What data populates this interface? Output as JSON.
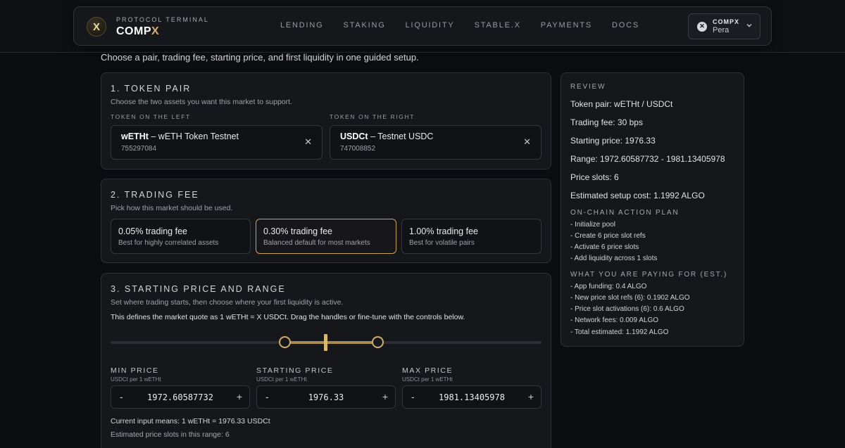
{
  "header": {
    "brand_sub": "PROTOCOL TERMINAL",
    "brand_name_main": "COMP",
    "brand_name_accent": "X",
    "logo_glyph": "X",
    "nav": [
      "LENDING",
      "STAKING",
      "LIQUIDITY",
      "STABLE.X",
      "PAYMENTS",
      "DOCS"
    ],
    "wallet": {
      "label": "COMPX",
      "name": "Pera",
      "icon": "pera-wallet-icon"
    }
  },
  "subtitle": "Choose a pair, trading fee, starting price, and first liquidity in one guided setup.",
  "token_pair": {
    "title": "1. TOKEN PAIR",
    "desc": "Choose the two assets you want this market to support.",
    "left_label": "TOKEN ON THE LEFT",
    "right_label": "TOKEN ON THE RIGHT",
    "left": {
      "symbol": "wETHt",
      "name": " – wETH Token Testnet",
      "id": "755297084"
    },
    "right": {
      "symbol": "USDCt",
      "name": " – Testnet USDC",
      "id": "747008852"
    },
    "clear_glyph": "✕"
  },
  "trading_fee": {
    "title": "2. TRADING FEE",
    "desc": "Pick how this market should be used.",
    "options": [
      {
        "title": "0.05% trading fee",
        "desc": "Best for highly correlated assets",
        "selected": false
      },
      {
        "title": "0.30% trading fee",
        "desc": "Balanced default for most markets",
        "selected": true
      },
      {
        "title": "1.00% trading fee",
        "desc": "Best for volatile pairs",
        "selected": false
      }
    ]
  },
  "price_range": {
    "title": "3. STARTING PRICE AND RANGE",
    "desc": "Set where trading starts, then choose where your first liquidity is active.",
    "note": "This defines the market quote as 1 wETHt = X USDCt. Drag the handles or fine-tune with the controls below.",
    "unit": "USDCt per 1 wETHt",
    "min": {
      "label": "MIN PRICE",
      "value": "1972.60587732"
    },
    "start": {
      "label": "STARTING PRICE",
      "value": "1976.33"
    },
    "max": {
      "label": "MAX PRICE",
      "value": "1981.13405978"
    },
    "minus": "-",
    "plus": "+",
    "current": "Current input means: 1 wETHt = 1976.33 USDCt",
    "slots": "Estimated price slots in this range: 6"
  },
  "review": {
    "heading": "REVIEW",
    "lines": [
      "Token pair: wETHt / USDCt",
      "Trading fee: 30 bps",
      "Starting price: 1976.33",
      "Range: 1972.60587732 - 1981.13405978",
      "Price slots: 6",
      "Estimated setup cost: 1.1992 ALGO"
    ],
    "plan_heading": "ON-CHAIN ACTION PLAN",
    "plan": [
      "- Initialize pool",
      "- Create 6 price slot refs",
      "- Activate 6 price slots",
      "- Add liquidity across 1 slots"
    ],
    "pay_heading": "WHAT YOU ARE PAYING FOR (EST.)",
    "pay": [
      "- App funding: 0.4 ALGO",
      "- New price slot refs (6): 0.1902 ALGO",
      "- Price slot activations (6): 0.6 ALGO",
      "- Network fees: 0.009 ALGO",
      "- Total estimated: 1.1992 ALGO"
    ]
  }
}
